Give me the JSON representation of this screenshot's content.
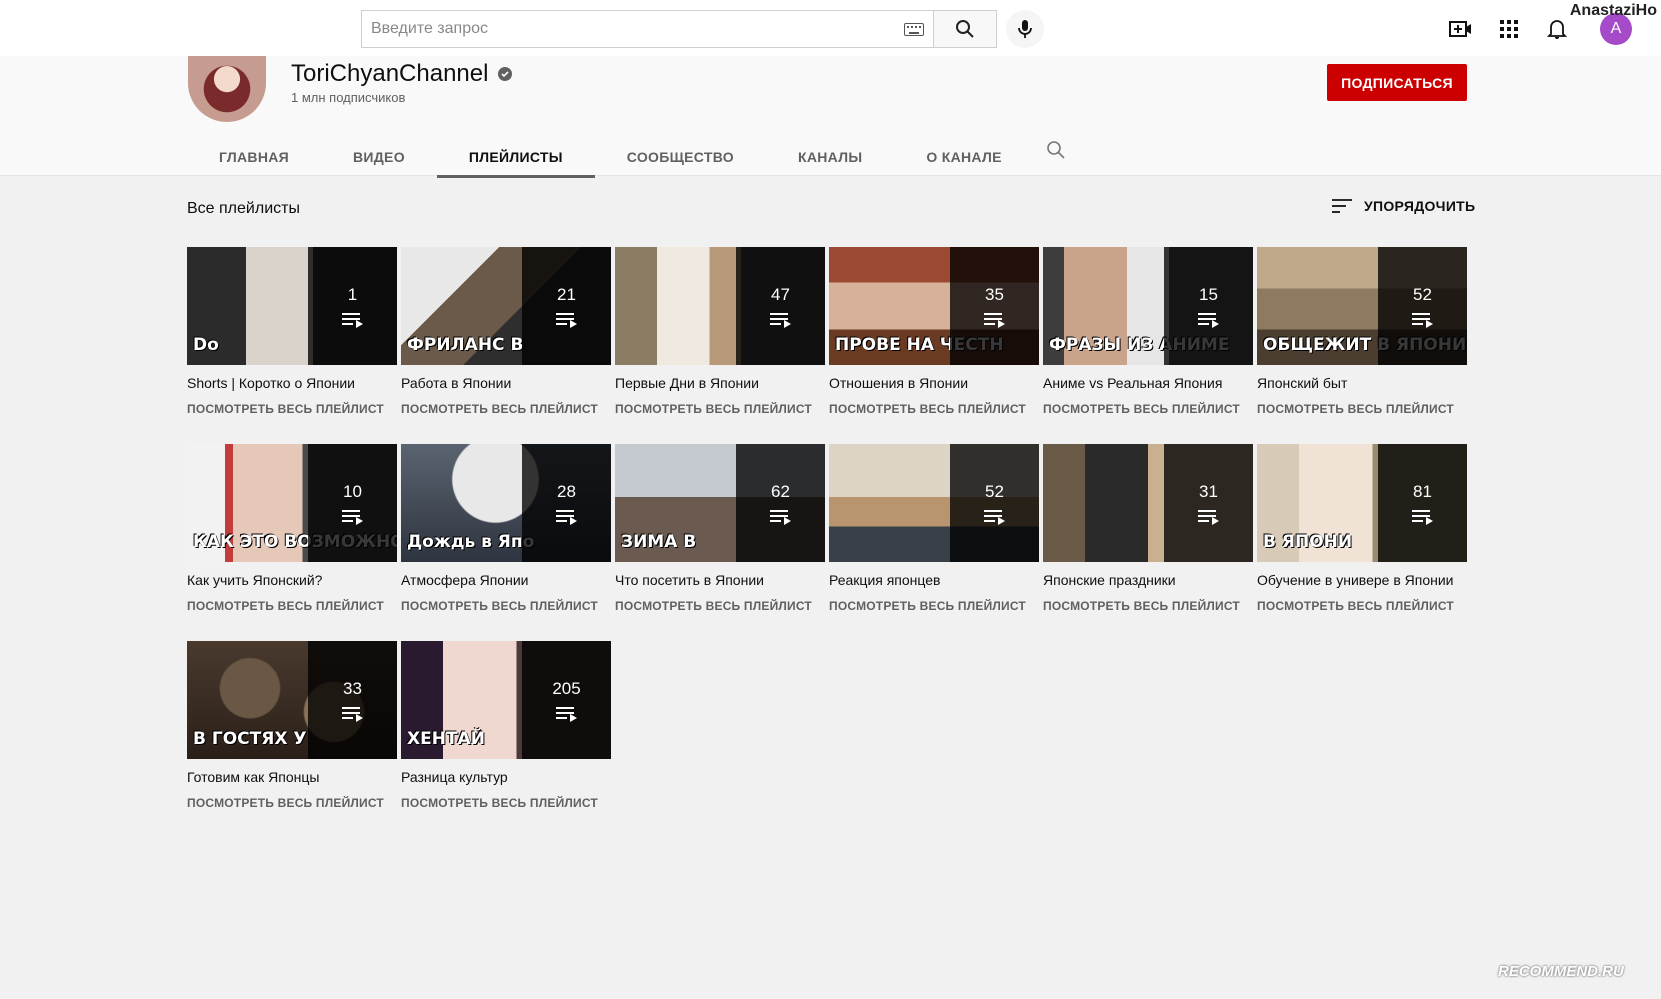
{
  "masthead": {
    "search_placeholder": "Введите запрос",
    "user_watermark": "AnastaziHo",
    "avatar_letter": "A"
  },
  "channel": {
    "name": "ToriChyanChannel",
    "subscribers": "1 млн подписчиков",
    "subscribe_label": "ПОДПИСАТЬСЯ"
  },
  "tabs": [
    {
      "label": "ГЛАВНАЯ"
    },
    {
      "label": "ВИДЕО"
    },
    {
      "label": "ПЛЕЙЛИСТЫ"
    },
    {
      "label": "СООБЩЕСТВО"
    },
    {
      "label": "КАНАЛЫ"
    },
    {
      "label": "О КАНАЛЕ"
    }
  ],
  "active_tab": "ПЛЕЙЛИСТЫ",
  "section": {
    "title": "Все плейлисты",
    "sort_label": "УПОРЯДОЧИТЬ"
  },
  "playlists": [
    {
      "title": "Shorts | Коротко о Японии",
      "count": "1",
      "link": "ПОСМОТРЕТЬ ВЕСЬ ПЛЕЙЛИСТ",
      "caption": "Do"
    },
    {
      "title": "Работа в Японии",
      "count": "21",
      "link": "ПОСМОТРЕТЬ ВЕСЬ ПЛЕЙЛИСТ",
      "caption": "ФРИЛАНС В"
    },
    {
      "title": "Первые Дни в Японии",
      "count": "47",
      "link": "ПОСМОТРЕТЬ ВЕСЬ ПЛЕЙЛИСТ",
      "caption": ""
    },
    {
      "title": "Отношения в Японии",
      "count": "35",
      "link": "ПОСМОТРЕТЬ ВЕСЬ ПЛЕЙЛИСТ",
      "caption": "ПРОВЕ НА ЧЕСТН"
    },
    {
      "title": "Аниме vs Реальная Япония",
      "count": "15",
      "link": "ПОСМОТРЕТЬ ВЕСЬ ПЛЕЙЛИСТ",
      "caption": "ФРАЗЫ ИЗ АНИМЕ"
    },
    {
      "title": "Японский быт",
      "count": "52",
      "link": "ПОСМОТРЕТЬ ВЕСЬ ПЛЕЙЛИСТ",
      "caption": "ОБЩЕЖИТ В ЯПОНИ"
    },
    {
      "title": "Как учить Японский?",
      "count": "10",
      "link": "ПОСМОТРЕТЬ ВЕСЬ ПЛЕЙЛИСТ",
      "caption": "КАК ЭТО ВОЗМОЖНО"
    },
    {
      "title": "Атмосфера Японии",
      "count": "28",
      "link": "ПОСМОТРЕТЬ ВЕСЬ ПЛЕЙЛИСТ",
      "caption": "Дождь в Япо"
    },
    {
      "title": "Что посетить в Японии",
      "count": "62",
      "link": "ПОСМОТРЕТЬ ВЕСЬ ПЛЕЙЛИСТ",
      "caption": "ЗИМА В"
    },
    {
      "title": "Реакция японцев",
      "count": "52",
      "link": "ПОСМОТРЕТЬ ВЕСЬ ПЛЕЙЛИСТ",
      "caption": ""
    },
    {
      "title": "Японские праздники",
      "count": "31",
      "link": "ПОСМОТРЕТЬ ВЕСЬ ПЛЕЙЛИСТ",
      "caption": ""
    },
    {
      "title": "Обучение в универе в Японии",
      "count": "81",
      "link": "ПОСМОТРЕТЬ ВЕСЬ ПЛЕЙЛИСТ",
      "caption": "В ЯПОНИ"
    },
    {
      "title": "Готовим как Японцы",
      "count": "33",
      "link": "ПОСМОТРЕТЬ ВЕСЬ ПЛЕЙЛИСТ",
      "caption": "В ГОСТЯХ У"
    },
    {
      "title": "Разница культур",
      "count": "205",
      "link": "ПОСМОТРЕТЬ ВЕСЬ ПЛЕЙЛИСТ",
      "caption": "ХЕНТАЙ"
    }
  ],
  "watermark": "RECOMMEND.RU",
  "colors": {
    "subscribe": "#cc0000",
    "avatar": "#a54bc9",
    "background": "#f1f1f1"
  }
}
